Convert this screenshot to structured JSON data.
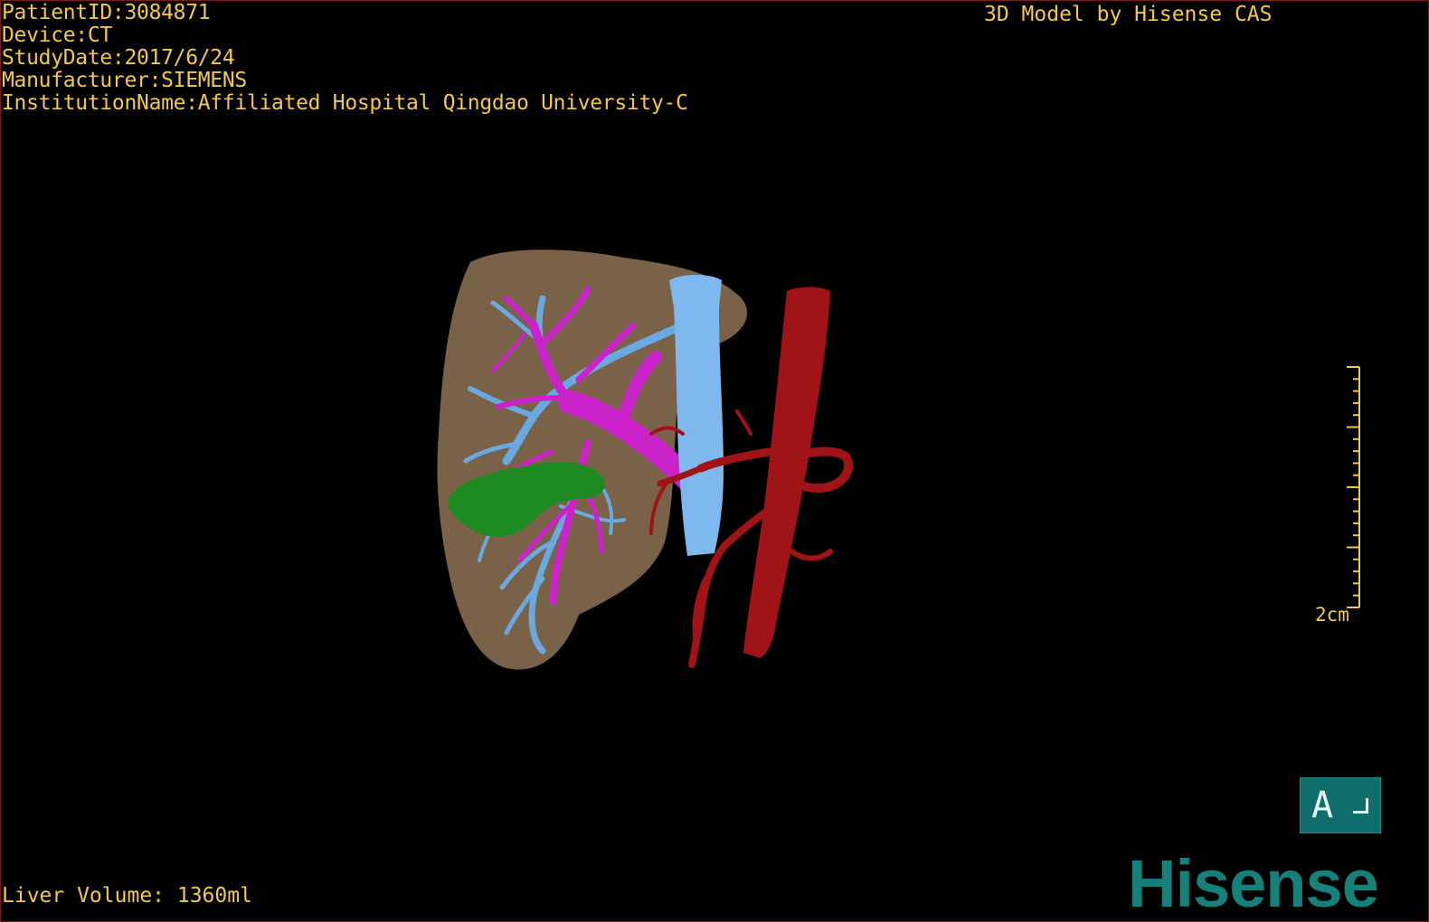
{
  "header": {
    "patient_id": "PatientID:3084871",
    "device": "Device:CT",
    "study_date": "StudyDate:2017/6/24",
    "manufacturer": "Manufacturer:SIEMENS",
    "institution": "InstitutionName:Affiliated Hospital Qingdao University-C"
  },
  "credit": "3D Model by Hisense CAS",
  "footer": {
    "liver_volume": "Liver Volume: 1360ml"
  },
  "scale_bar": {
    "label": "2cm"
  },
  "orientation": {
    "label": "A"
  },
  "brand": {
    "logo_text": "Hisense"
  },
  "colors": {
    "liver": "#7a6248",
    "portal_vein": "#cc22cc",
    "hepatic_vein": "#6aa8e0",
    "ivc": "#7fb8ee",
    "aorta": "#a01418",
    "gallbladder": "#1e8a22",
    "text": "#f2c94c",
    "orientation_box": "#0f6e6c",
    "brand": "#16807a"
  },
  "icons": {
    "orientation": "orientation-cube-icon",
    "scale": "scale-ruler-icon"
  }
}
